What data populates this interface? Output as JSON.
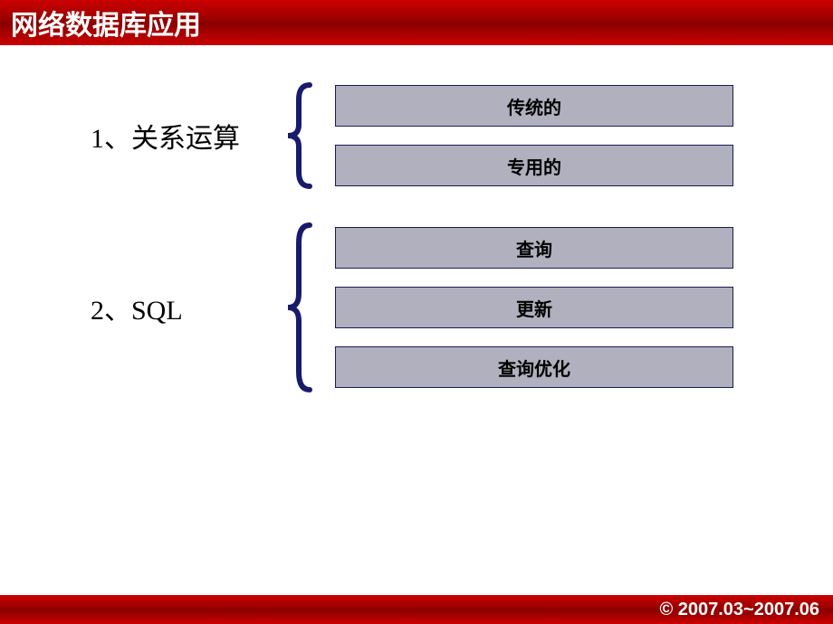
{
  "header": {
    "title": "网络数据库应用"
  },
  "sections": [
    {
      "label": "1、关系运算",
      "items": [
        "传统的",
        "专用的"
      ]
    },
    {
      "label": "2、SQL",
      "items": [
        "查询",
        "更新",
        "查询优化"
      ]
    }
  ],
  "footer": {
    "text": "© 2007.03~2007.06"
  }
}
